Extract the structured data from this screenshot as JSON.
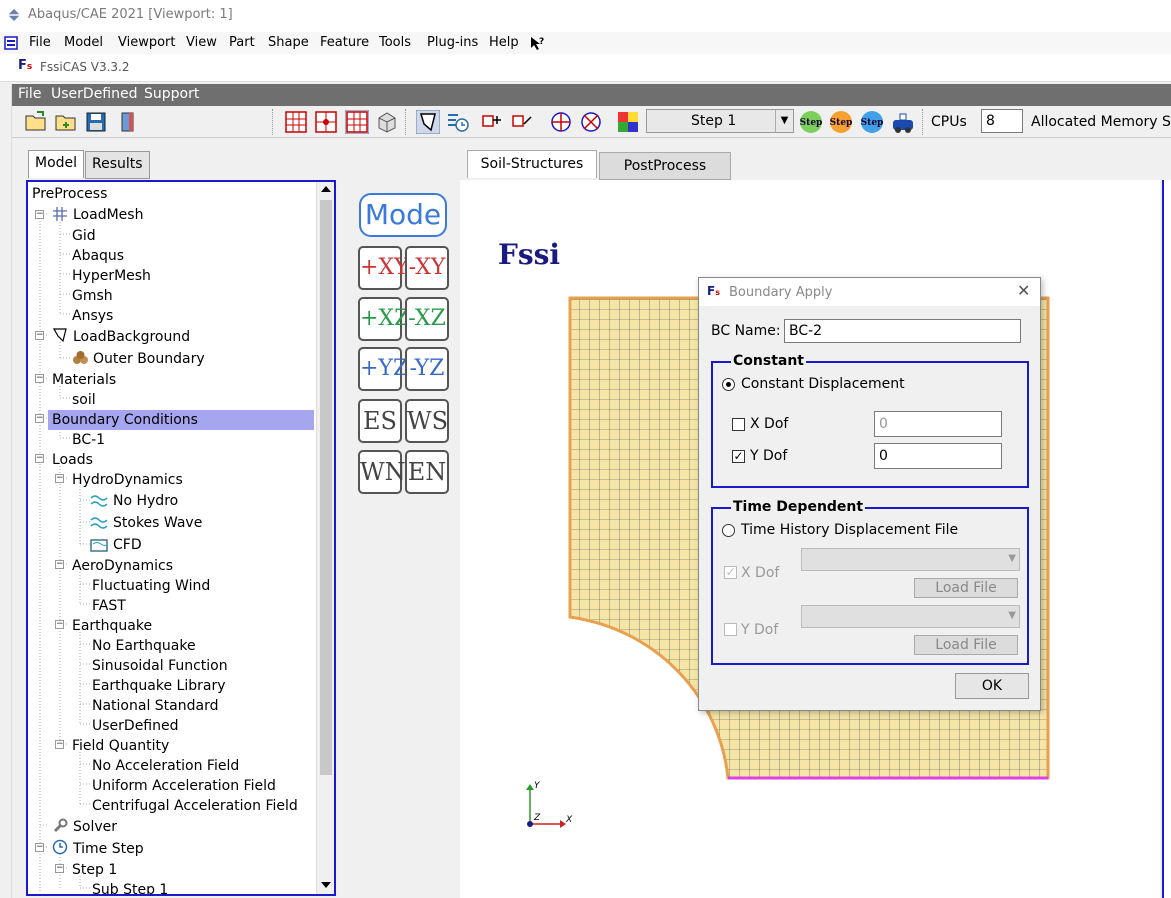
{
  "window": {
    "title": "Abaqus/CAE 2021 [Viewport: 1]"
  },
  "abaqus_menu": [
    "File",
    "Model",
    "Viewport",
    "View",
    "Part",
    "Shape",
    "Feature",
    "Tools",
    "Plug-ins",
    "Help"
  ],
  "plugin": {
    "title": "FssiCAS V3.3.2",
    "logo": "Fssi"
  },
  "plugin_menu": [
    "File",
    "UserDefined",
    "Support"
  ],
  "toolbar": {
    "step_select": "Step 1",
    "step_buttons": [
      "Step",
      "Step",
      "Step"
    ],
    "cpus_label": "CPUs",
    "cpus_value": "8",
    "memory_label": "Allocated Memory Si"
  },
  "left_tabs": [
    "Model",
    "Results"
  ],
  "tree": {
    "preprocess": "PreProcess",
    "loadmesh": "LoadMesh",
    "mesh_items": [
      "Gid",
      "Abaqus",
      "HyperMesh",
      "Gmsh",
      "Ansys"
    ],
    "loadbackground": "LoadBackground",
    "outer_boundary": "Outer Boundary",
    "materials": "Materials",
    "soil": "soil",
    "boundary_conditions": "Boundary Conditions",
    "bc1": "BC-1",
    "loads": "Loads",
    "hydrodynamics": "HydroDynamics",
    "hydro_items": [
      "No Hydro",
      "Stokes Wave",
      "CFD"
    ],
    "aerodynamics": "AeroDynamics",
    "aero_items": [
      "Fluctuating Wind",
      "FAST"
    ],
    "earthquake": "Earthquake",
    "eq_items": [
      "No Earthquake",
      "Sinusoidal Function",
      "Earthquake Library",
      "National Standard",
      "UserDefined"
    ],
    "field_quantity": "Field Quantity",
    "field_items": [
      "No Acceleration Field",
      "Uniform Acceleration Field",
      "Centrifugal Acceleration Field"
    ],
    "solver": "Solver",
    "time_step": "Time Step",
    "step1": "Step 1",
    "substep": "Sub Step 1"
  },
  "view_tabs": [
    "Soil-Structures",
    "PostProcess"
  ],
  "view_buttons": {
    "mode": "Mode",
    "xy_pos": "+XY",
    "xy_neg": "-XY",
    "xz_pos": "+XZ",
    "xz_neg": "-XZ",
    "yz_pos": "+YZ",
    "yz_neg": "-YZ",
    "es": "ES",
    "ws": "WS",
    "wn": "WN",
    "en": "EN"
  },
  "axes": {
    "y": "Y",
    "z": "Z",
    "x": "X"
  },
  "dialog": {
    "title": "Boundary Apply",
    "bc_name_label": "BC Name:",
    "bc_name_value": "BC-2",
    "constant_group": "Constant",
    "constant_disp": "Constant Displacement",
    "xdof_label": "X Dof",
    "xdof_value": "0",
    "ydof_label": "Y Dof",
    "ydof_value": "0",
    "time_group": "Time Dependent",
    "time_history": "Time History Displacement File",
    "td_xdof": "X Dof",
    "td_ydof": "Y Dof",
    "load_file": "Load File",
    "ok": "OK"
  },
  "colors": {
    "accent": "#1a1acc",
    "selection": "#a6a6f0",
    "mesh_fill": "#f5e6a8",
    "mesh_edge": "#e8a050"
  }
}
